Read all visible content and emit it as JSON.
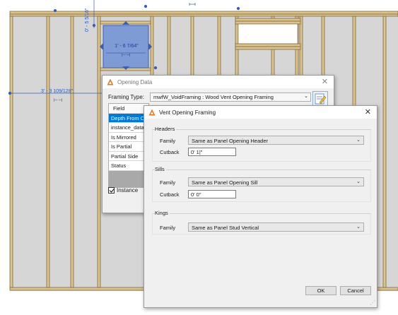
{
  "canvas": {
    "dimensions": {
      "left_width": "3' - 3 109/128\"",
      "vertical_depth": "0' - 5 5/16\"",
      "opening_width": "1' - 6 7/64\""
    },
    "colors": {
      "panel": "#d6d6d6",
      "stud": "#dcc28c",
      "stud_edge": "#7f6b42",
      "selection": "#7f9bd6"
    }
  },
  "opening_data": {
    "title": "Opening Data",
    "framing_type_label": "Framing Type:",
    "framing_type_value": "mwfW_VoidFraming : Wood Vent Opening Framing",
    "grid_header": "Field",
    "grid_rows": [
      "Depth From Cent",
      "instance_data",
      "Is Mirrored",
      "Is Partial",
      "Partial Side",
      "Status"
    ],
    "selected_row": "Depth From Cent",
    "instance_label": "Instance",
    "instance_checked": true
  },
  "vent_dialog": {
    "title": "Vent Opening Framing",
    "close_glyph": "✕",
    "headers": {
      "legend": "Headers",
      "family_label": "Family",
      "family_value": "Same as Panel Opening Header",
      "cutback_label": "Cutback",
      "cutback_value": "0' 1|\""
    },
    "sills": {
      "legend": "Sills",
      "family_label": "Family",
      "family_value": "Same as Panel Opening Sill",
      "cutback_label": "Cutback",
      "cutback_value": "0' 0\""
    },
    "kings": {
      "legend": "Kings",
      "family_label": "Family",
      "family_value": "Same as Panel Stud Vertical"
    },
    "ok_label": "OK",
    "cancel_label": "Cancel"
  },
  "icons": [
    "app-logo-icon",
    "close-icon",
    "chevron-down-icon",
    "edit-pencil-icon",
    "resize-grip-icon"
  ]
}
